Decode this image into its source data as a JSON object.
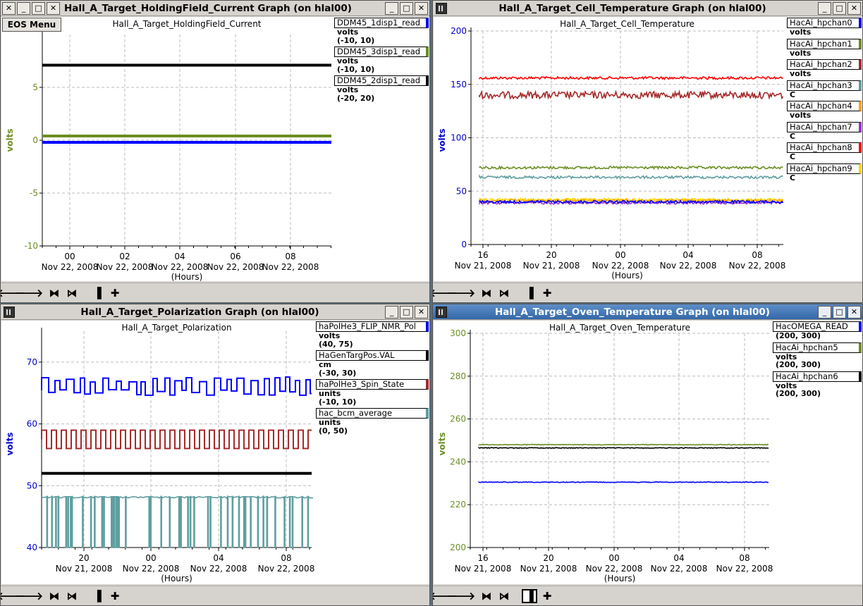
{
  "eos_menu": "EOS Menu",
  "toolbar_icons": [
    "left-arrow-icon",
    "right-arrow-icon",
    "zoom-in-icon",
    "zoom-out-icon",
    "plot-mode-icon",
    "add-icon"
  ],
  "win1": {
    "title": "Hall_A_Target_HoldingField_Current Graph (on hlal00)",
    "chart_title": "Hall_A_Target_HoldingField_Current",
    "legend": [
      {
        "name": "DDM45_1disp1_read",
        "unit": "volts",
        "range": "(-10, 10)",
        "color": "#0000ff"
      },
      {
        "name": "DDM45_3disp1_read",
        "unit": "volts",
        "range": "(-10, 10)",
        "color": "#6b8e23"
      },
      {
        "name": "DDM45_2disp1_read",
        "unit": "volts",
        "range": "(-20, 20)",
        "color": "#000000"
      }
    ]
  },
  "win2": {
    "title": "Hall_A_Target_Cell_Temperature Graph (on hlal00)",
    "chart_title": "Hall_A_Target_Cell_Temperature",
    "legend": [
      {
        "name": "HacAi_hpchan0",
        "unit": "volts",
        "color": "#0000ff"
      },
      {
        "name": "HacAi_hpchan1",
        "unit": "volts",
        "color": "#6b8e23"
      },
      {
        "name": "HacAi_hpchan2",
        "unit": "volts",
        "color": "#a52a2a"
      },
      {
        "name": "HacAi_hpchan3",
        "unit": "C",
        "color": "#5f9ea0"
      },
      {
        "name": "HacAi_hpchan4",
        "unit": "volts",
        "color": "#ffa500"
      },
      {
        "name": "HacAi_hpchan7",
        "unit": "C",
        "color": "#9932cc"
      },
      {
        "name": "HacAi_hpchan8",
        "unit": "C",
        "color": "#ff0000"
      },
      {
        "name": "HacAi_hpchan9",
        "unit": "C",
        "color": "#ffd700"
      }
    ]
  },
  "win3": {
    "title": "Hall_A_Target_Polarization Graph (on hlal00)",
    "chart_title": "Hall_A_Target_Polarization",
    "legend": [
      {
        "name": "haPolHe3_FLIP_NMR_Pol",
        "unit": "volts",
        "range": "(40, 75)",
        "color": "#0000ff"
      },
      {
        "name": "HaGenTargPos.VAL",
        "unit": "cm",
        "range": "(-30, 30)",
        "color": "#000000"
      },
      {
        "name": "haPolHe3_Spin_State",
        "unit": "units",
        "range": "(-10, 10)",
        "color": "#a52a2a"
      },
      {
        "name": "hac_bcm_average",
        "unit": "units",
        "range": "(0, 50)",
        "color": "#5f9ea0"
      }
    ]
  },
  "win4": {
    "title": "Hall_A_Target_Oven_Temperature Graph (on hlal00)",
    "chart_title": "Hall_A_Target_Oven_Temperature",
    "legend": [
      {
        "name": "HacOMEGA_READ",
        "unit": "",
        "range": "(200, 300)",
        "color": "#0000ff"
      },
      {
        "name": "HacAi_hpchan5",
        "unit": "volts",
        "range": "(200, 300)",
        "color": "#6b8e23"
      },
      {
        "name": "HacAi_hpchan6",
        "unit": "volts",
        "range": "(200, 300)",
        "color": "#000000"
      }
    ]
  },
  "chart_data": [
    {
      "type": "line",
      "title": "Hall_A_Target_HoldingField_Current",
      "ylabel": "volts",
      "xlabel": "(Hours)",
      "ylim": [
        -10,
        10
      ],
      "yticks": [
        "5",
        "0",
        "-5",
        "-10"
      ],
      "xticks": [
        {
          "hour": "00",
          "date": "Nov 22, 2008"
        },
        {
          "hour": "02",
          "date": "Nov 22, 2008"
        },
        {
          "hour": "04",
          "date": "Nov 22, 2008"
        },
        {
          "hour": "06",
          "date": "Nov 22, 2008"
        },
        {
          "hour": "08",
          "date": "Nov 22, 2008"
        }
      ],
      "series": [
        {
          "name": "DDM45_2disp1_read",
          "color": "#000000",
          "value": 7.1
        },
        {
          "name": "DDM45_3disp1_read",
          "color": "#6b8e23",
          "value": 0.4
        },
        {
          "name": "DDM45_1disp1_read",
          "color": "#0000ff",
          "value": -0.2
        }
      ]
    },
    {
      "type": "line",
      "title": "Hall_A_Target_Cell_Temperature",
      "ylabel": "volts",
      "xlabel": "(Hours)",
      "ylim": [
        0,
        200
      ],
      "yticks": [
        "200",
        "150",
        "100",
        "50",
        "0"
      ],
      "xticks": [
        {
          "hour": "16",
          "date": "Nov 21, 2008"
        },
        {
          "hour": "20",
          "date": "Nov 21, 2008"
        },
        {
          "hour": "00",
          "date": "Nov 22, 2008"
        },
        {
          "hour": "04",
          "date": "Nov 22, 2008"
        },
        {
          "hour": "08",
          "date": "Nov 22, 2008"
        }
      ],
      "series": [
        {
          "name": "HacAi_hpchan8",
          "color": "#ff0000",
          "value": 156
        },
        {
          "name": "HacAi_hpchan2",
          "color": "#a52a2a",
          "value": 140
        },
        {
          "name": "HacAi_hpchan1",
          "color": "#6b8e23",
          "value": 72
        },
        {
          "name": "HacAi_hpchan3",
          "color": "#5f9ea0",
          "value": 63
        },
        {
          "name": "HacAi_hpchan9",
          "color": "#ffd700",
          "value": 42
        },
        {
          "name": "HacAi_hpchan4",
          "color": "#ffa500",
          "value": 41
        },
        {
          "name": "HacAi_hpchan7",
          "color": "#9932cc",
          "value": 39
        },
        {
          "name": "HacAi_hpchan0",
          "color": "#0000ff",
          "value": 40
        }
      ]
    },
    {
      "type": "line",
      "title": "Hall_A_Target_Polarization",
      "ylabel": "volts",
      "xlabel": "(Hours)",
      "ylim": [
        40,
        75
      ],
      "yticks": [
        "70",
        "60",
        "50",
        "40"
      ],
      "xticks": [
        {
          "hour": "20",
          "date": "Nov 21, 2008"
        },
        {
          "hour": "00",
          "date": "Nov 22, 2008"
        },
        {
          "hour": "04",
          "date": "Nov 22, 2008"
        },
        {
          "hour": "08",
          "date": "Nov 22, 2008"
        }
      ],
      "series": [
        {
          "name": "haPolHe3_FLIP_NMR_Pol",
          "color": "#0000ff",
          "value": 66
        },
        {
          "name": "haPolHe3_Spin_State",
          "color": "#a52a2a",
          "value": 57.5
        },
        {
          "name": "HaGenTargPos.VAL",
          "color": "#000000",
          "value": 52
        },
        {
          "name": "hac_bcm_average",
          "color": "#5f9ea0",
          "value": 48
        }
      ]
    },
    {
      "type": "line",
      "title": "Hall_A_Target_Oven_Temperature",
      "ylabel": "volts",
      "xlabel": "(Hours)",
      "ylim": [
        200,
        300
      ],
      "yticks": [
        "300",
        "280",
        "260",
        "240",
        "220",
        "200"
      ],
      "xticks": [
        {
          "hour": "16",
          "date": "Nov 21, 2008"
        },
        {
          "hour": "20",
          "date": "Nov 21, 2008"
        },
        {
          "hour": "00",
          "date": "Nov 22, 2008"
        },
        {
          "hour": "04",
          "date": "Nov 22, 2008"
        },
        {
          "hour": "08",
          "date": "Nov 22, 2008"
        }
      ],
      "series": [
        {
          "name": "HacAi_hpchan5",
          "color": "#6b8e23",
          "value": 248
        },
        {
          "name": "HacAi_hpchan6",
          "color": "#000000",
          "value": 246.5
        },
        {
          "name": "HacOMEGA_READ",
          "color": "#0000ff",
          "value": 230.5
        }
      ]
    }
  ]
}
